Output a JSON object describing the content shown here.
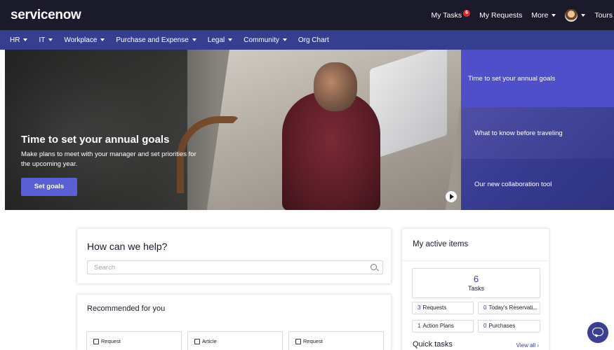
{
  "brand": {
    "logo": "servicenow"
  },
  "top_nav": {
    "my_tasks": "My Tasks",
    "tasks_badge": "6",
    "my_requests": "My Requests",
    "more": "More",
    "tours": "Tours"
  },
  "menu": {
    "items": [
      {
        "label": "HR",
        "dropdown": true
      },
      {
        "label": "IT",
        "dropdown": true
      },
      {
        "label": "Workplace",
        "dropdown": true
      },
      {
        "label": "Purchase and Expense",
        "dropdown": true
      },
      {
        "label": "Legal",
        "dropdown": true
      },
      {
        "label": "Community",
        "dropdown": true
      },
      {
        "label": "Org Chart",
        "dropdown": false
      }
    ]
  },
  "hero": {
    "title": "Time to set your annual goals",
    "description": "Make plans to meet with your manager and set priorities for the upcoming year.",
    "button": "Set goals"
  },
  "carousel": {
    "slides": [
      {
        "label": "Time to set your annual goals",
        "active": true
      },
      {
        "label": "What to know before traveling",
        "active": false
      },
      {
        "label": "Our new collaboration tool",
        "active": false
      }
    ]
  },
  "help": {
    "title": "How can we help?",
    "search_placeholder": "Search"
  },
  "recommended": {
    "title": "Recommended for you",
    "items": [
      {
        "type": "Request",
        "icon": "edit-icon"
      },
      {
        "type": "Article",
        "icon": "article-icon"
      },
      {
        "type": "Request",
        "icon": "edit-icon"
      }
    ]
  },
  "active_items": {
    "title": "My active items",
    "tasks_count": "6",
    "tasks_label": "Tasks",
    "requests_count": "3",
    "requests_label": "Requests",
    "reservations_count": "0",
    "reservations_label": "Today's Reservati...",
    "action_plans_count": "1",
    "action_plans_label": "Action Plans",
    "purchases_count": "0",
    "purchases_label": "Purchases"
  },
  "quick_tasks": {
    "title": "Quick tasks",
    "view_all": "View all"
  },
  "colors": {
    "topbar": "#1a1a2b",
    "navbar": "#353e8f",
    "accent": "#5a60d3",
    "badge": "#e0262f"
  }
}
